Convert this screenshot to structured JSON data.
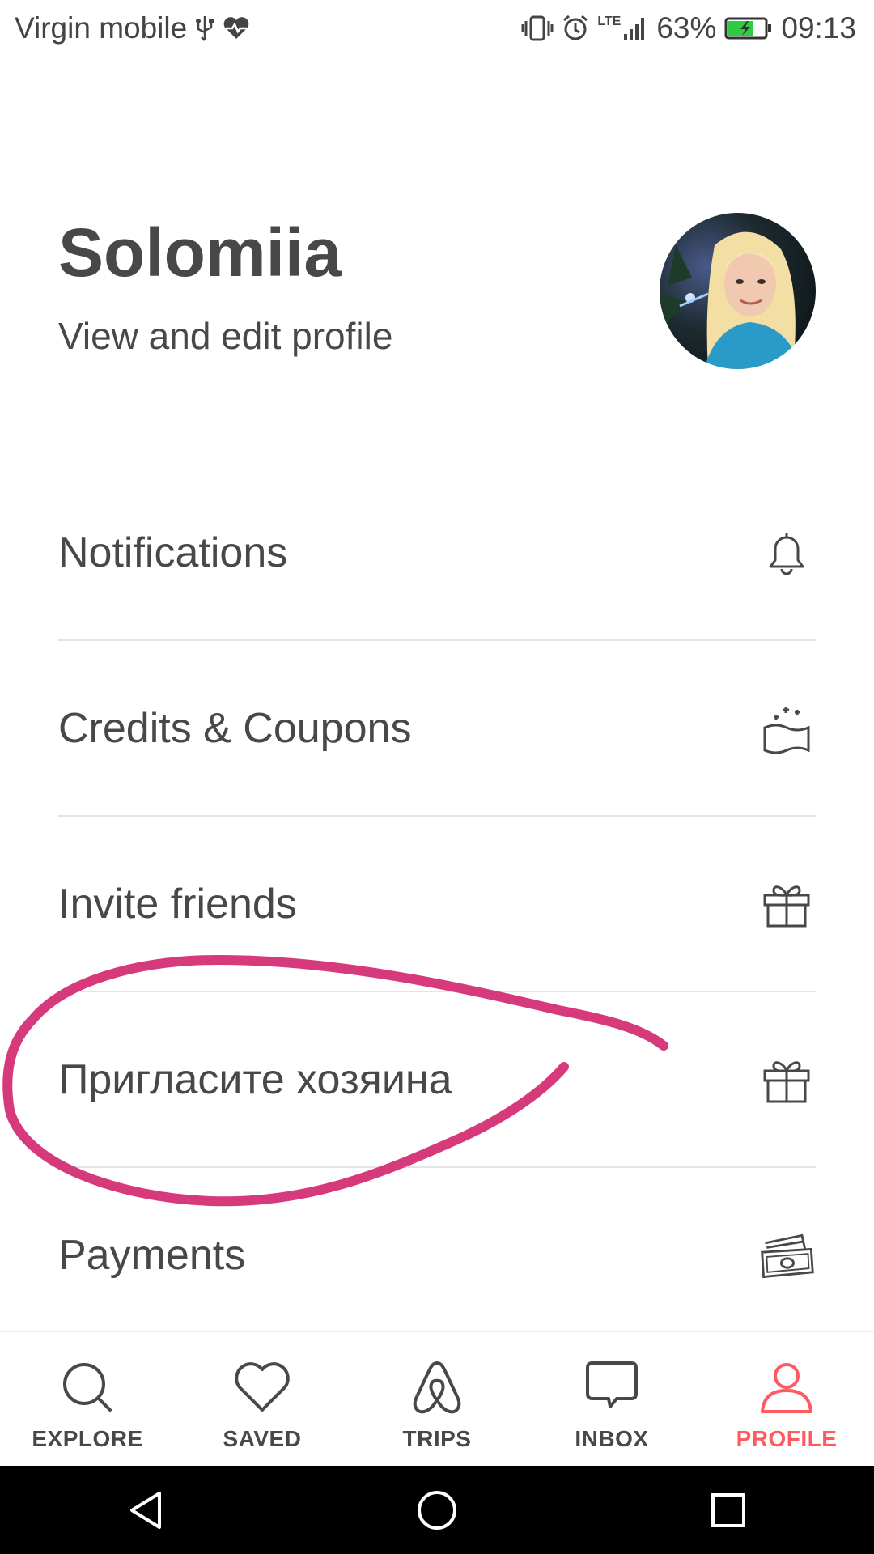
{
  "status_bar": {
    "carrier": "Virgin mobile",
    "network": "LTE",
    "battery": "63%",
    "time": "09:13",
    "icons": [
      "usb-icon",
      "heart-pulse-icon",
      "vibrate-icon",
      "alarm-icon",
      "signal-icon",
      "battery-charging-icon"
    ]
  },
  "profile": {
    "name": "Solomiia",
    "link": "View and edit profile",
    "avatar_icon": "avatar"
  },
  "menu": {
    "items": [
      {
        "label": "Notifications",
        "icon": "bell-icon"
      },
      {
        "label": "Credits & Coupons",
        "icon": "coupon-icon"
      },
      {
        "label": "Invite friends",
        "icon": "gift-icon"
      },
      {
        "label": "Пригласите хозяина",
        "icon": "gift-icon"
      },
      {
        "label": "Payments",
        "icon": "payment-cards-icon"
      }
    ]
  },
  "annotation": {
    "color": "#d63a7c"
  },
  "tabs": [
    {
      "label": "EXPLORE",
      "icon": "search-icon",
      "active": false
    },
    {
      "label": "SAVED",
      "icon": "heart-icon",
      "active": false
    },
    {
      "label": "TRIPS",
      "icon": "airbnb-logo-icon",
      "active": false
    },
    {
      "label": "INBOX",
      "icon": "chat-icon",
      "active": false
    },
    {
      "label": "PROFILE",
      "icon": "person-icon",
      "active": true
    }
  ],
  "colors": {
    "accent": "#ff5a5f",
    "text": "#484848",
    "divider": "#e4e4e4"
  }
}
